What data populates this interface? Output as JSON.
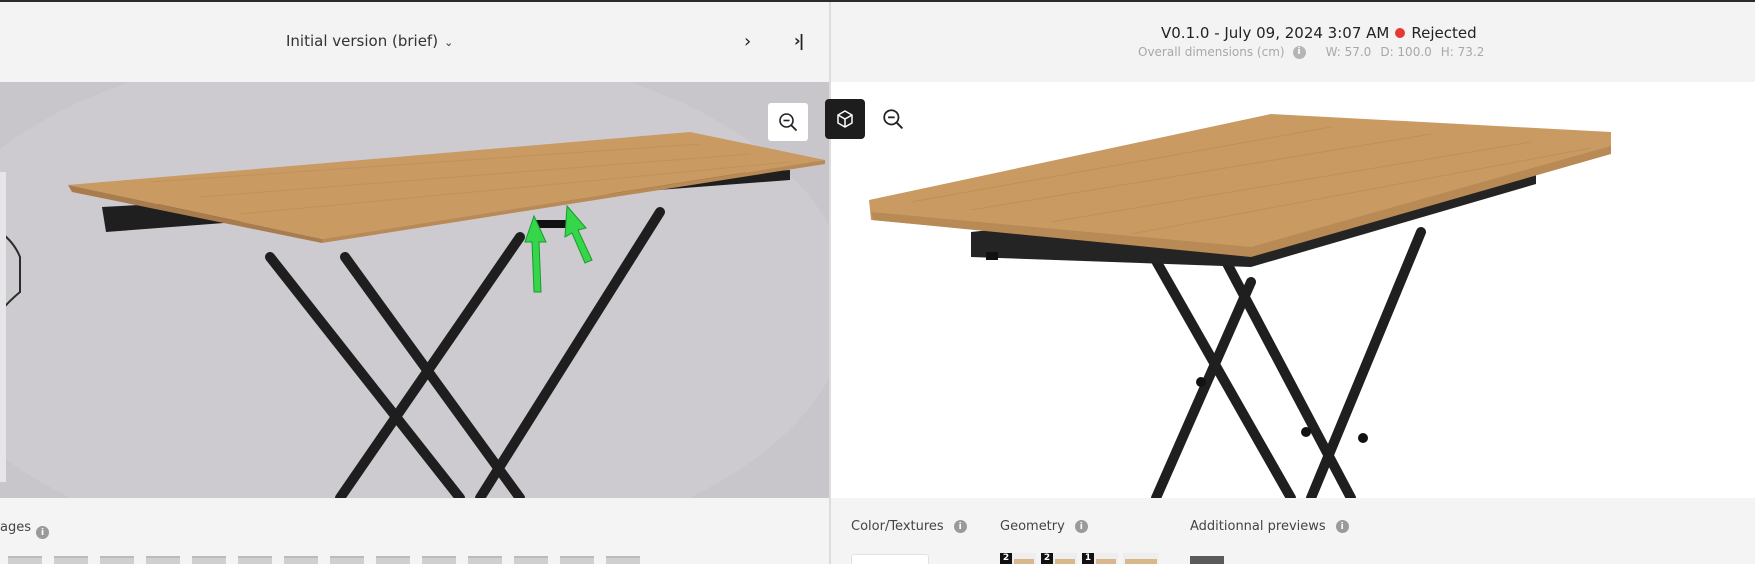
{
  "left": {
    "version_select": "Initial version (brief)",
    "chevron_glyph": "⌄",
    "next_glyph": "›",
    "last_glyph": "›|",
    "reference_label": "ages"
  },
  "right": {
    "version": "V0.1.0 - July 09, 2024 3:07 AM",
    "status": "Rejected",
    "dimensions_label": "Overall dimensions (cm)",
    "width": "W: 57.0",
    "depth": "D: 100.0",
    "height": "H: 73.2",
    "sections": {
      "color_textures": "Color/Textures",
      "geometry": "Geometry",
      "additional_previews": "Additionnal previews"
    },
    "geometry_badges": [
      "2",
      "2",
      "1"
    ]
  },
  "info_glyph": "i",
  "colors": {
    "status_red": "#e53935",
    "wood": "#c99a62",
    "frame": "#1e1e1e"
  }
}
